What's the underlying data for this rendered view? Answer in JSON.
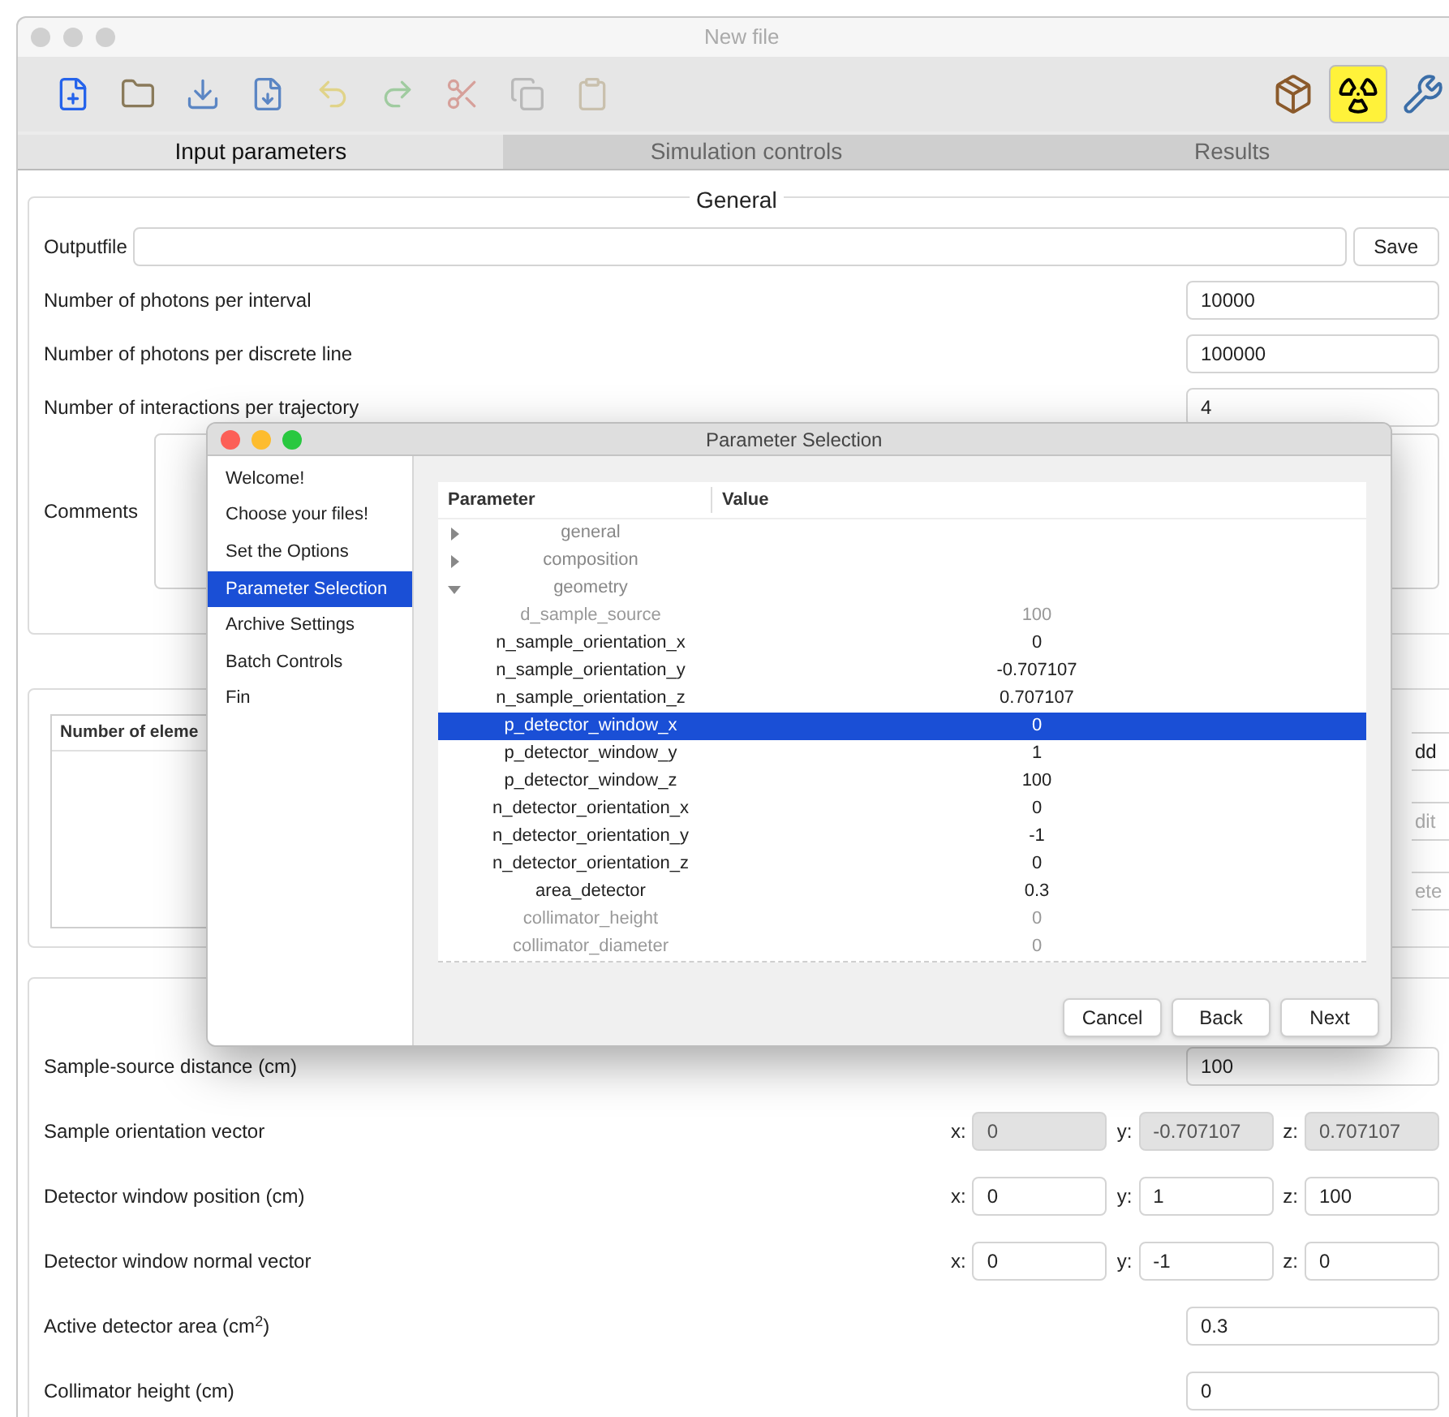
{
  "window": {
    "title": "New file"
  },
  "toolbar": {
    "left": [
      {
        "kind": "new",
        "disabled": false
      },
      {
        "kind": "open",
        "disabled": false
      },
      {
        "kind": "save",
        "disabled": false
      },
      {
        "kind": "save_as",
        "disabled": false
      },
      {
        "kind": "undo",
        "disabled": true
      },
      {
        "kind": "redo",
        "disabled": true
      },
      {
        "kind": "cut",
        "disabled": true
      },
      {
        "kind": "copy",
        "disabled": true
      },
      {
        "kind": "paste",
        "disabled": true
      }
    ],
    "right": [
      {
        "kind": "package",
        "selected": false
      },
      {
        "kind": "radiation",
        "selected": true
      },
      {
        "kind": "tools",
        "selected": false
      }
    ]
  },
  "tabs": [
    {
      "label": "Input parameters",
      "selected": true
    },
    {
      "label": "Simulation controls",
      "selected": false
    },
    {
      "label": "Results",
      "selected": false
    }
  ],
  "general": {
    "title": "General",
    "outputfile": {
      "label": "Outputfile",
      "button": "Save"
    },
    "rows": [
      {
        "label": "Number of photons per interval",
        "value": "10000"
      },
      {
        "label": "Number of photons per discrete line",
        "value": "100000"
      },
      {
        "label": "Number of interactions per trajectory",
        "value": "4"
      }
    ],
    "comments": {
      "label": "Comments"
    }
  },
  "elements": {
    "column_1": "Number of eleme",
    "buttons": [
      {
        "label": "dd",
        "disabled": false
      },
      {
        "label": "dit",
        "disabled": true
      },
      {
        "label": "ete",
        "disabled": true
      }
    ]
  },
  "geometry_rows": [
    {
      "kind": "single",
      "label": "Sample-source distance (cm)",
      "value": "100"
    },
    {
      "kind": "vector",
      "label": "Sample orientation vector",
      "disabled": true,
      "fields": [
        {
          "axis": "x:",
          "value": "0"
        },
        {
          "axis": "y:",
          "value": "-0.707107"
        },
        {
          "axis": "z:",
          "value": "0.707107"
        }
      ]
    },
    {
      "kind": "vector",
      "label": "Detector window position (cm)",
      "disabled": false,
      "fields": [
        {
          "axis": "x:",
          "value": "0"
        },
        {
          "axis": "y:",
          "value": "1"
        },
        {
          "axis": "z:",
          "value": "100"
        }
      ]
    },
    {
      "kind": "vector",
      "label": "Detector window normal vector",
      "disabled": false,
      "fields": [
        {
          "axis": "x:",
          "value": "0"
        },
        {
          "axis": "y:",
          "value": "-1"
        },
        {
          "axis": "z:",
          "value": "0"
        }
      ]
    },
    {
      "kind": "single",
      "label": "Active detector area (cm$^{2}$)",
      "value": "0.3"
    },
    {
      "kind": "single",
      "label": "Collimator height (cm)",
      "value": "0"
    }
  ],
  "dialog": {
    "title": "Parameter Selection",
    "steps": [
      {
        "label": "Welcome!",
        "selected": false
      },
      {
        "label": "Choose your files!",
        "selected": false
      },
      {
        "label": "Set the Options",
        "selected": false
      },
      {
        "label": "Parameter Selection",
        "selected": true
      },
      {
        "label": "Archive Settings",
        "selected": false
      },
      {
        "label": "Batch Controls",
        "selected": false
      },
      {
        "label": "Fin",
        "selected": false
      }
    ],
    "columns": [
      "Parameter",
      "Value"
    ],
    "tree": [
      {
        "name": "general",
        "expanded": false
      },
      {
        "name": "composition",
        "expanded": false
      },
      {
        "name": "geometry",
        "expanded": true,
        "children": [
          {
            "name": "d_sample_source",
            "value": "100",
            "disabled": true,
            "selected": false
          },
          {
            "name": "n_sample_orientation_x",
            "value": "0",
            "disabled": false,
            "selected": false
          },
          {
            "name": "n_sample_orientation_y",
            "value": "-0.707107",
            "disabled": false,
            "selected": false
          },
          {
            "name": "n_sample_orientation_z",
            "value": "0.707107",
            "disabled": false,
            "selected": false
          },
          {
            "name": "p_detector_window_x",
            "value": "0",
            "disabled": false,
            "selected": true
          },
          {
            "name": "p_detector_window_y",
            "value": "1",
            "disabled": false,
            "selected": false
          },
          {
            "name": "p_detector_window_z",
            "value": "100",
            "disabled": false,
            "selected": false
          },
          {
            "name": "n_detector_orientation_x",
            "value": "0",
            "disabled": false,
            "selected": false
          },
          {
            "name": "n_detector_orientation_y",
            "value": "-1",
            "disabled": false,
            "selected": false
          },
          {
            "name": "n_detector_orientation_z",
            "value": "0",
            "disabled": false,
            "selected": false
          },
          {
            "name": "area_detector",
            "value": "0.3",
            "disabled": false,
            "selected": false
          },
          {
            "name": "collimator_height",
            "value": "0",
            "disabled": true,
            "selected": false
          },
          {
            "name": "collimator_diameter",
            "value": "0",
            "disabled": true,
            "selected": false
          }
        ]
      }
    ],
    "buttons": [
      "Cancel",
      "Back",
      "Next"
    ]
  }
}
